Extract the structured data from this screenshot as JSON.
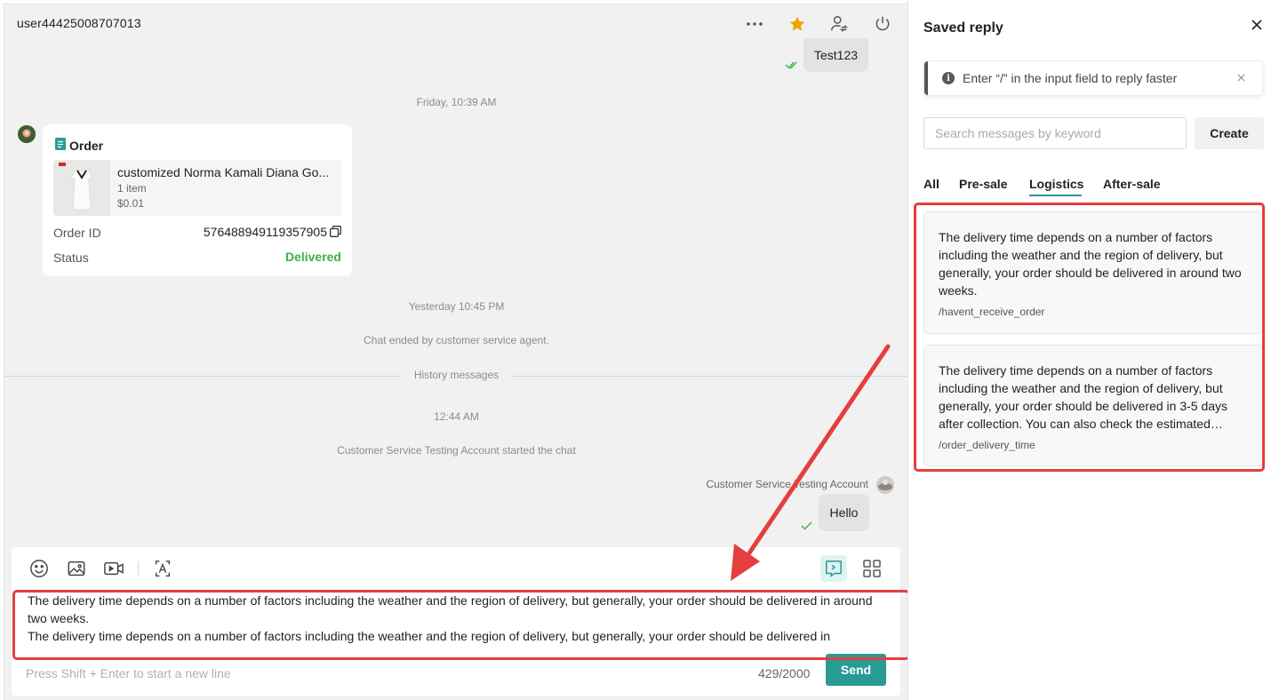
{
  "chat": {
    "username": "user44425008707013",
    "messages": {
      "test_bubble": "Test123",
      "time_friday": "Friday, 10:39 AM",
      "time_yesterday": "Yesterday 10:45 PM",
      "chat_ended": "Chat ended by customer service agent.",
      "history": "History messages",
      "time_today": "12:44 AM",
      "chat_started": "Customer Service Testing Account started the chat",
      "agent_name": "Customer Service Testing Account",
      "hello_bubble": "Hello"
    },
    "order": {
      "title": "Order",
      "product_name": "customized Norma Kamali Diana Go...",
      "quantity": "1 item",
      "price": "$0.01",
      "id_label": "Order ID",
      "id_value": "576488949119357905",
      "status_label": "Status",
      "status_value": "Delivered"
    }
  },
  "composer": {
    "lines": [
      "The delivery time depends on a number of factors including the weather and the region of delivery, but generally, your order should be delivered in around two weeks.",
      "The delivery time depends on a number of factors including the weather and the region of delivery, but generally, your order should be delivered in"
    ],
    "hint": "Press Shift + Enter to start a new line",
    "count": "429/2000",
    "send_label": "Send"
  },
  "panel": {
    "title": "Saved reply",
    "tip": "Enter “/” in the input field to reply faster",
    "search_placeholder": "Search messages by keyword",
    "create_label": "Create",
    "tabs": [
      "All",
      "Pre-sale",
      "Logistics",
      "After-sale"
    ],
    "active_tab": "Logistics",
    "replies": [
      {
        "text": "The delivery time depends on a number of factors including the weather and the region of delivery, but generally, your order should be delivered in around two weeks.",
        "shortcut": "/havent_receive_order"
      },
      {
        "text": "The delivery time depends on a number of factors including the weather and the region of delivery, but generally, your order should be delivered in 3-5 days after collection. You can also check the estimated…",
        "shortcut": "/order_delivery_time"
      }
    ]
  },
  "colors": {
    "accent": "#2a9b93",
    "delivered": "#3bb346",
    "star": "#f0a500",
    "annotation": "#e53e3e",
    "chat_bg": "#f1f1f1"
  },
  "icons": [
    "more-icon",
    "star-icon",
    "transfer-user-icon",
    "power-icon",
    "emoji-icon",
    "image-icon",
    "video-icon",
    "translate-icon",
    "saved-reply-icon",
    "grid-icon",
    "close-icon",
    "info-icon",
    "copy-icon",
    "document-icon",
    "double-check-icon"
  ]
}
